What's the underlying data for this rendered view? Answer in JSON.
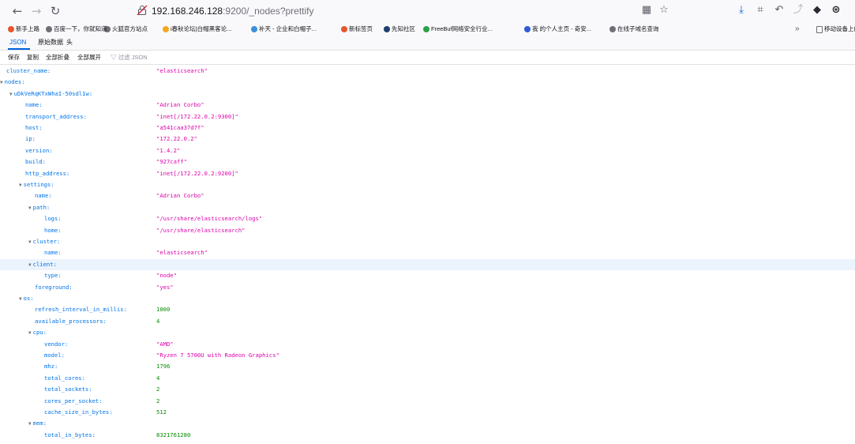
{
  "browser": {
    "url_host": "192.168.246.128",
    "url_rest": ":9200/_nodes?prettify",
    "icons": {
      "back": "back-arrow-icon",
      "forward": "forward-arrow-icon",
      "reload": "reload-icon"
    }
  },
  "bookmarks": [
    {
      "label": "新手上路",
      "color": "#e8562a"
    },
    {
      "label": "百度一下，你就知道",
      "color": "#6f6f78"
    },
    {
      "label": "火狐官方站点",
      "color": "#6f6f78"
    },
    {
      "label": "i春秋论坛|白帽黑客论...",
      "color": "#f5a623"
    },
    {
      "label": "补天 - 企业和白帽子...",
      "color": "#3b8fd9"
    },
    {
      "label": "新标签页",
      "color": "#e8562a"
    },
    {
      "label": "先知社区",
      "color": "#1f3f6e"
    },
    {
      "label": "FreeBuf网络安全行业...",
      "color": "#2ca04a"
    },
    {
      "label": "我 的个人主页 - 奇安...",
      "color": "#2f5bd6"
    },
    {
      "label": "在线子域名查询",
      "color": "#6f6f78"
    }
  ],
  "bookmarks_overflow": "»",
  "mobile_bookmarks": "移动设备上的",
  "json_tabs": [
    "JSON",
    "原始数据",
    "头"
  ],
  "actions": [
    "保存",
    "复制",
    "全部折叠",
    "全部展开"
  ],
  "filter_placeholder": "过滤 JSON",
  "rows": [
    {
      "k": "cluster_name:",
      "v": "\"elasticsearch\"",
      "t": "str",
      "d": 0
    },
    {
      "k": "nodes:",
      "v": "",
      "t": "",
      "d": 0,
      "tw": true
    },
    {
      "k": "uDkVeRqKTxWhaI-50sdl1w:",
      "v": "",
      "t": "",
      "d": 1,
      "tw": true
    },
    {
      "k": "name:",
      "v": "\"Adrian Corbo\"",
      "t": "str",
      "d": 2
    },
    {
      "k": "transport_address:",
      "v": "\"inet[/172.22.0.2:9300]\"",
      "t": "str",
      "d": 2
    },
    {
      "k": "host:",
      "v": "\"a541caa37d7f\"",
      "t": "str",
      "d": 2
    },
    {
      "k": "ip:",
      "v": "\"172.22.0.2\"",
      "t": "str",
      "d": 2
    },
    {
      "k": "version:",
      "v": "\"1.4.2\"",
      "t": "str",
      "d": 2
    },
    {
      "k": "build:",
      "v": "\"927caff\"",
      "t": "str",
      "d": 2
    },
    {
      "k": "http_address:",
      "v": "\"inet[/172.22.0.2:9200]\"",
      "t": "str",
      "d": 2
    },
    {
      "k": "settings:",
      "v": "",
      "t": "",
      "d": 2,
      "tw": true
    },
    {
      "k": "name:",
      "v": "\"Adrian Corbo\"",
      "t": "str",
      "d": 3
    },
    {
      "k": "path:",
      "v": "",
      "t": "",
      "d": 3,
      "tw": true
    },
    {
      "k": "logs:",
      "v": "\"/usr/share/elasticsearch/logs\"",
      "t": "str",
      "d": 4
    },
    {
      "k": "home:",
      "v": "\"/usr/share/elasticsearch\"",
      "t": "str",
      "d": 4
    },
    {
      "k": "cluster:",
      "v": "",
      "t": "",
      "d": 3,
      "tw": true
    },
    {
      "k": "name:",
      "v": "\"elasticsearch\"",
      "t": "str",
      "d": 4
    },
    {
      "k": "client:",
      "v": "",
      "t": "",
      "d": 3,
      "tw": true,
      "hl": true
    },
    {
      "k": "type:",
      "v": "\"node\"",
      "t": "str",
      "d": 4
    },
    {
      "k": "foreground:",
      "v": "\"yes\"",
      "t": "str",
      "d": 3
    },
    {
      "k": "os:",
      "v": "",
      "t": "",
      "d": 2,
      "tw": true
    },
    {
      "k": "refresh_interval_in_millis:",
      "v": "1000",
      "t": "num",
      "d": 3
    },
    {
      "k": "available_processors:",
      "v": "4",
      "t": "num",
      "d": 3
    },
    {
      "k": "cpu:",
      "v": "",
      "t": "",
      "d": 3,
      "tw": true
    },
    {
      "k": "vendor:",
      "v": "\"AMD\"",
      "t": "str",
      "d": 4
    },
    {
      "k": "model:",
      "v": "\"Ryzen 7 5700U with Radeon Graphics\"",
      "t": "str",
      "d": 4
    },
    {
      "k": "mhz:",
      "v": "1796",
      "t": "num",
      "d": 4
    },
    {
      "k": "total_cores:",
      "v": "4",
      "t": "num",
      "d": 4
    },
    {
      "k": "total_sockets:",
      "v": "2",
      "t": "num",
      "d": 4
    },
    {
      "k": "cores_per_socket:",
      "v": "2",
      "t": "num",
      "d": 4
    },
    {
      "k": "cache_size_in_bytes:",
      "v": "512",
      "t": "num",
      "d": 4
    },
    {
      "k": "mem:",
      "v": "",
      "t": "",
      "d": 3,
      "tw": true
    },
    {
      "k": "total_in_bytes:",
      "v": "8321761280",
      "t": "num",
      "d": 4
    }
  ]
}
